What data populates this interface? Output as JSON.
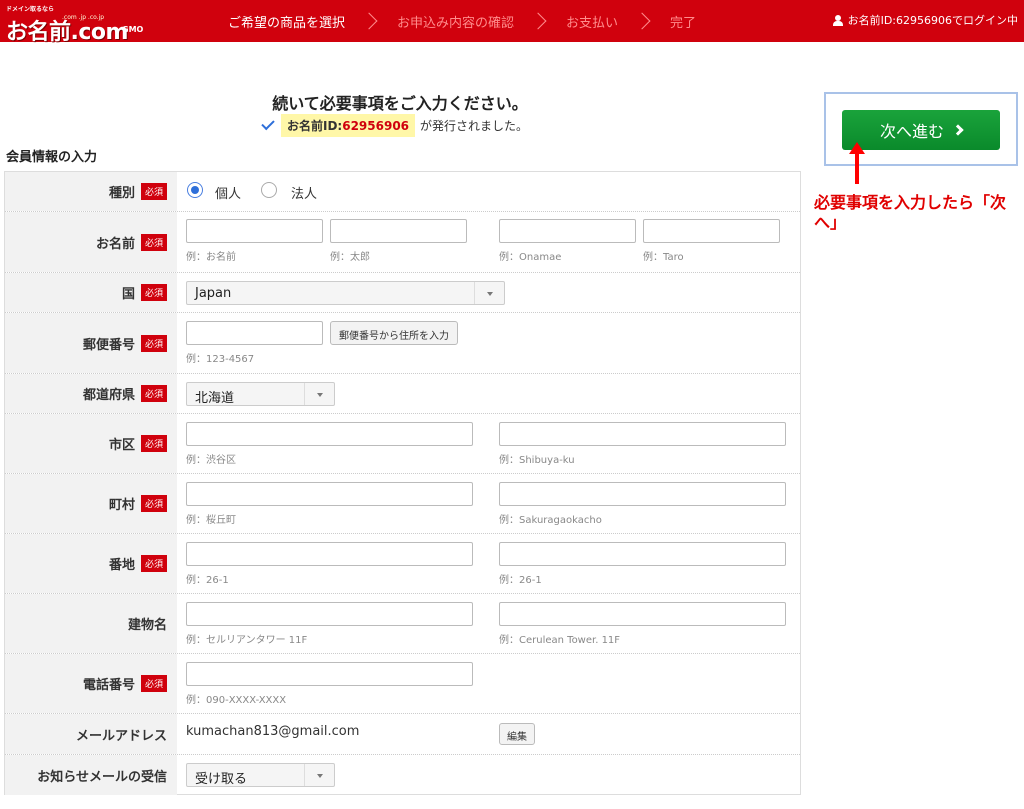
{
  "header": {
    "logo_small": "ドメイン取るなら",
    "logo_tld": ".com .jp .co.jp",
    "logo_main": "お名前.com",
    "logo_gmo": "GMO",
    "steps": [
      "ご希望の商品を選択",
      "お申込み内容の確認",
      "お支払い",
      "完了"
    ],
    "login_text": "お名前ID:62956906でログイン中"
  },
  "intro": {
    "heading": "続いて必要事項をご入力ください。",
    "id_label": "お名前ID:",
    "id_value": "62956906",
    "issued_text": "が発行されました。",
    "section_title": "会員情報の入力"
  },
  "required_label": "必須",
  "form": {
    "type": {
      "label": "種別",
      "option_individual": "個人",
      "option_corporate": "法人"
    },
    "name": {
      "label": "お名前",
      "hint_last": "例：お名前",
      "hint_first": "例：太郎",
      "hint_last_en": "例：Onamae",
      "hint_first_en": "例：Taro"
    },
    "country": {
      "label": "国",
      "value": "Japan"
    },
    "postal": {
      "label": "郵便番号",
      "button": "郵便番号から住所を入力",
      "hint": "例：123-4567"
    },
    "prefecture": {
      "label": "都道府県",
      "value": "北海道"
    },
    "city": {
      "label": "市区",
      "hint": "例：渋谷区",
      "hint_en": "例：Shibuya-ku"
    },
    "town": {
      "label": "町村",
      "hint": "例：桜丘町",
      "hint_en": "例：Sakuragaokacho"
    },
    "street": {
      "label": "番地",
      "hint": "例：26-1",
      "hint_en": "例：26-1"
    },
    "building": {
      "label": "建物名",
      "hint": "例：セルリアンタワー 11F",
      "hint_en": "例：Cerulean Tower. 11F"
    },
    "phone": {
      "label": "電話番号",
      "hint": "例：090-XXXX-XXXX"
    },
    "email": {
      "label": "メールアドレス",
      "value": "kumachan813@gmail.com",
      "edit": "編集"
    },
    "newsletter": {
      "label": "お知らせメールの受信",
      "value": "受け取る"
    }
  },
  "next_button": "次へ進む",
  "annotation": "必要事項を入力したら「次へ」",
  "colors": {
    "brand_red": "#d0010d",
    "button_green": "#0a8a2b",
    "annotation_red": "#e00000"
  }
}
